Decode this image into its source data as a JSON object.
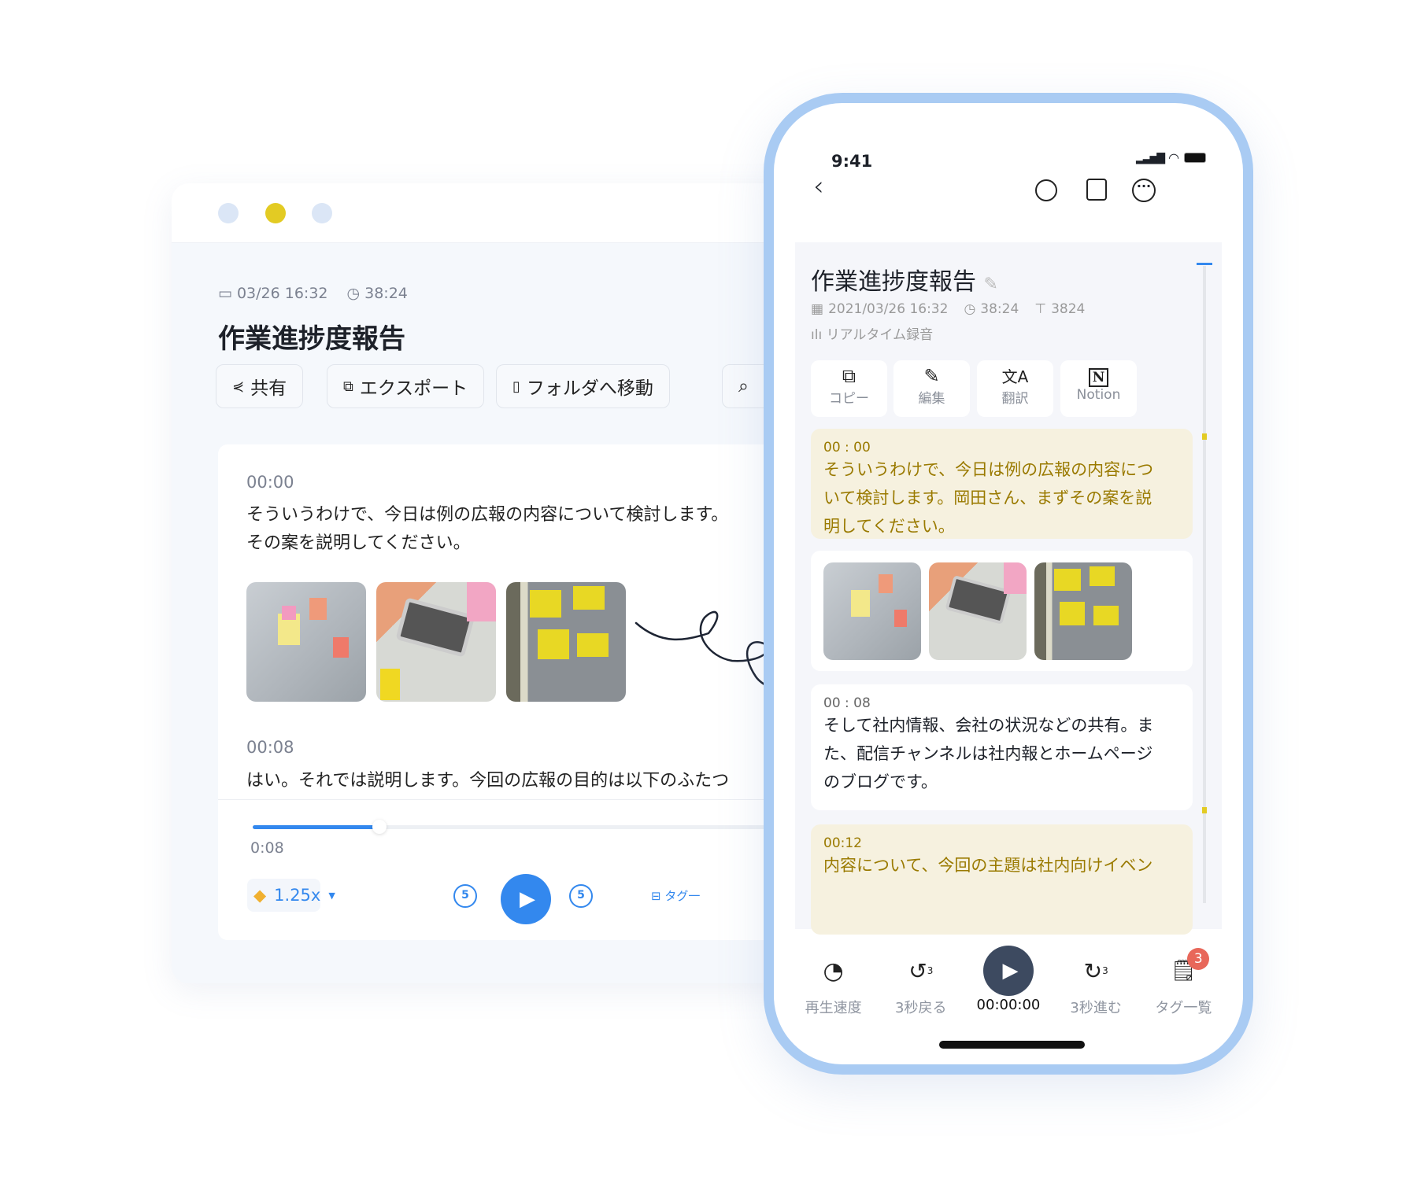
{
  "desktop": {
    "window_dots": [
      "#dbe6f6",
      "#e3cb23",
      "#dbe6f6"
    ],
    "date": "03/26 16:32",
    "duration": "38:24",
    "title": "作業進捗度報告",
    "buttons": [
      "共有",
      "エクスポート",
      "フォルダへ移動"
    ],
    "segments": [
      {
        "time": "00:00",
        "lines": [
          "そういうわけで、今日は例の広報の内容について検討します。",
          "その案を説明してください。"
        ]
      },
      {
        "time": "00:08",
        "lines": [
          "はい。それでは説明します。今回の広報の目的は以下のふたつ"
        ]
      }
    ],
    "player": {
      "current": "0:08",
      "progress_percent": 25,
      "speed": "1.25x",
      "rewind_seconds": "5",
      "forward_seconds": "5",
      "tag_label": "タグ一",
      "accent": "#3388ee"
    }
  },
  "phone": {
    "status_time": "9:41",
    "title": "作業進捗度報告",
    "datetime": "2021/03/26 16:32",
    "duration": "38:24",
    "chars": "3824",
    "mode": "リアルタイム録音",
    "actions": [
      "コピー",
      "編集",
      "翻訳",
      "Notion"
    ],
    "segments": [
      {
        "time": "00 : 00",
        "lines": [
          "そういうわけで、今日は例の広報の内容につ",
          "いて検討します。岡田さん、まずその案を説",
          "明してください。"
        ]
      },
      {
        "time": "00 : 08",
        "lines": [
          "そして社内情報、会社の状況などの共有。ま",
          "た、配信チャンネルは社内報とホームページ",
          "のブログです。"
        ]
      },
      {
        "time": "00:12",
        "lines": [
          "内容について、今回の主題は社内向けイベン"
        ]
      }
    ],
    "bottom_bar": {
      "speed": "再生速度",
      "back": "3秒戻る",
      "time": "00:00:00",
      "forward": "3秒進む",
      "tags": "タグ一覧",
      "tag_count": "3",
      "skip": "3"
    }
  }
}
